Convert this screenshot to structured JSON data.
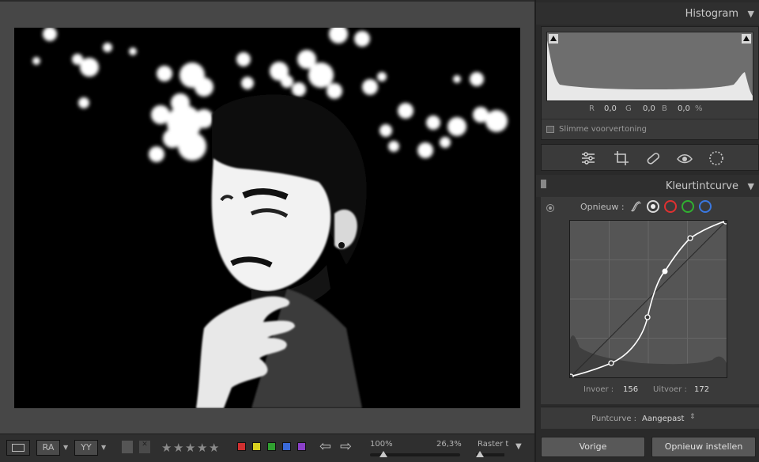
{
  "histogram": {
    "title": "Histogram",
    "r_label": "R",
    "r_value": "0,0",
    "g_label": "G",
    "g_value": "0,0",
    "b_label": "B",
    "b_value": "0,0",
    "percent": "%",
    "smart_preview": "Slimme voorvertoning"
  },
  "tools": [
    "sliders-icon",
    "crop-icon",
    "healing-icon",
    "redeye-icon",
    "mask-icon"
  ],
  "tone_curve": {
    "title": "Kleurtintcurve",
    "reset_label": "Opnieuw :",
    "input_label": "Invoer :",
    "input_value": "156",
    "output_label": "Uitvoer :",
    "output_value": "172",
    "point_curve_label": "Puntcurve :",
    "point_curve_value": "Aangepast",
    "channel_colors": {
      "rgb": "#d9d9d9",
      "red": "#e03030",
      "green": "#30b030",
      "blue": "#3a78e0"
    }
  },
  "buttons": {
    "previous": "Vorige",
    "reset": "Opnieuw instellen"
  },
  "toolbar": {
    "zoom_fit": "100%",
    "zoom_value": "26,3%",
    "grid_label": "Raster t",
    "color_labels": [
      "#d03030",
      "#d8d020",
      "#30a030",
      "#3a6ad8",
      "#8a40c8"
    ],
    "rating_stars": 5
  },
  "colors": {
    "panel_bg": "#2a2a2a",
    "stage_bg": "#474747"
  }
}
